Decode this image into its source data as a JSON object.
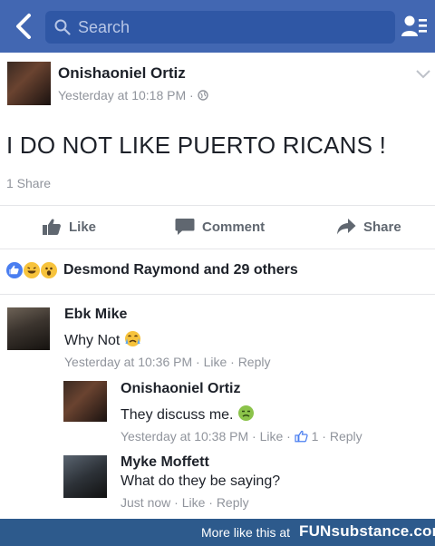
{
  "search": {
    "placeholder": "Search"
  },
  "post": {
    "author": "Onishaoniel Ortiz",
    "time": "Yesterday at 10:18 PM · ",
    "text": "I DO NOT LIKE  PUERTO RICANS !",
    "shares": "1 Share"
  },
  "actions": {
    "like": "Like",
    "comment": "Comment",
    "share": "Share"
  },
  "reactions": {
    "summary": "Desmond Raymond and 29 others"
  },
  "comments": [
    {
      "name": "Ebk Mike",
      "text": "Why Not",
      "time": "Yesterday at 10:36 PM · Like · Reply"
    },
    {
      "name": "Onishaoniel Ortiz",
      "text": "They discuss me.",
      "time": "Yesterday at 10:38 PM · Like · ",
      "likes": "1",
      "reply": " · Reply"
    },
    {
      "name": "Myke Moffett",
      "text": "What do they be saying?",
      "time": "Just now · Like · Reply"
    }
  ],
  "footer": {
    "more": "More like this at",
    "brand": "FUNsubstance.com"
  },
  "colors": {
    "topbar": "#4267b2",
    "footer": "#2d5a8c"
  }
}
